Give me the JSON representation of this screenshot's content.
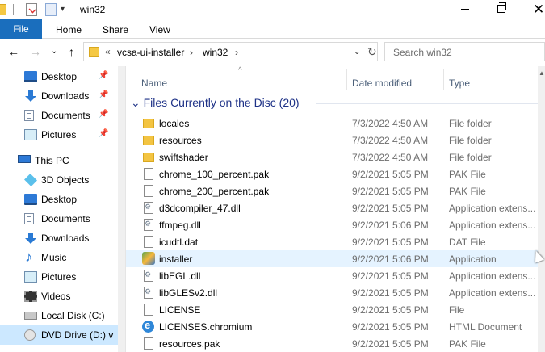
{
  "window": {
    "title": "win32",
    "quick_access_dropdown": "▾",
    "close_glyph": "✕"
  },
  "ribbon": {
    "file": "File",
    "home": "Home",
    "share": "Share",
    "view": "View"
  },
  "nav_buttons": {
    "back": "←",
    "forward": "→",
    "recent": "⌄",
    "up": "↑"
  },
  "address": {
    "overflow": "«",
    "crumbs": [
      "vcsa-ui-installer",
      "win32"
    ],
    "separator": "›",
    "dropdown": "⌄",
    "refresh": "↻"
  },
  "search": {
    "placeholder": "Search win32"
  },
  "navpane": {
    "pin_glyph": "📌",
    "quick_access": [
      {
        "label": "Desktop",
        "icon": "desktop-icon"
      },
      {
        "label": "Downloads",
        "icon": "downloads-icon"
      },
      {
        "label": "Documents",
        "icon": "documents-icon"
      },
      {
        "label": "Pictures",
        "icon": "pictures-icon"
      }
    ],
    "this_pc": "This PC",
    "pc_items": [
      {
        "label": "3D Objects",
        "icon": "3d-objects-icon"
      },
      {
        "label": "Desktop",
        "icon": "desktop-icon"
      },
      {
        "label": "Documents",
        "icon": "documents-icon"
      },
      {
        "label": "Downloads",
        "icon": "downloads-icon"
      },
      {
        "label": "Music",
        "icon": "music-icon"
      },
      {
        "label": "Pictures",
        "icon": "pictures-icon"
      },
      {
        "label": "Videos",
        "icon": "videos-icon"
      },
      {
        "label": "Local Disk (C:)",
        "icon": "local-disk-icon"
      },
      {
        "label": "DVD Drive (D:) v",
        "icon": "dvd-drive-icon"
      }
    ]
  },
  "columns": {
    "name": "Name",
    "date": "Date modified",
    "type": "Type",
    "sort_glyph": "^"
  },
  "group": {
    "chevron": "⌄",
    "title": "Files Currently on the Disc (20)"
  },
  "files": [
    {
      "name": "locales",
      "date": "7/3/2022 4:50 AM",
      "type": "File folder",
      "icon": "folder"
    },
    {
      "name": "resources",
      "date": "7/3/2022 4:50 AM",
      "type": "File folder",
      "icon": "folder"
    },
    {
      "name": "swiftshader",
      "date": "7/3/2022 4:50 AM",
      "type": "File folder",
      "icon": "folder"
    },
    {
      "name": "chrome_100_percent.pak",
      "date": "9/2/2021 5:05 PM",
      "type": "PAK File",
      "icon": "file"
    },
    {
      "name": "chrome_200_percent.pak",
      "date": "9/2/2021 5:05 PM",
      "type": "PAK File",
      "icon": "file"
    },
    {
      "name": "d3dcompiler_47.dll",
      "date": "9/2/2021 5:05 PM",
      "type": "Application extens...",
      "icon": "dll"
    },
    {
      "name": "ffmpeg.dll",
      "date": "9/2/2021 5:06 PM",
      "type": "Application extens...",
      "icon": "dll"
    },
    {
      "name": "icudtl.dat",
      "date": "9/2/2021 5:05 PM",
      "type": "DAT File",
      "icon": "file"
    },
    {
      "name": "installer",
      "date": "9/2/2021 5:06 PM",
      "type": "Application",
      "icon": "app"
    },
    {
      "name": "libEGL.dll",
      "date": "9/2/2021 5:05 PM",
      "type": "Application extens...",
      "icon": "dll"
    },
    {
      "name": "libGLESv2.dll",
      "date": "9/2/2021 5:05 PM",
      "type": "Application extens...",
      "icon": "dll"
    },
    {
      "name": "LICENSE",
      "date": "9/2/2021 5:05 PM",
      "type": "File",
      "icon": "file"
    },
    {
      "name": "LICENSES.chromium",
      "date": "9/2/2021 5:05 PM",
      "type": "HTML Document",
      "icon": "html"
    },
    {
      "name": "resources.pak",
      "date": "9/2/2021 5:05 PM",
      "type": "PAK File",
      "icon": "file"
    }
  ],
  "scroll_up_glyph": "▲"
}
